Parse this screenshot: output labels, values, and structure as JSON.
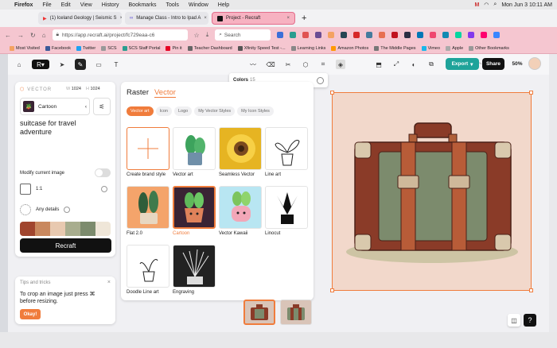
{
  "menubar": {
    "app": "Firefox",
    "items": [
      "File",
      "Edit",
      "View",
      "History",
      "Bookmarks",
      "Tools",
      "Window",
      "Help"
    ],
    "clock": "Mon Jun 3  10:11 AM"
  },
  "tabs": [
    {
      "title": "(1) Iceland Geology | Seismic S"
    },
    {
      "title": "Manage Class - Intro to Ipad A"
    },
    {
      "title": "Project - Recraft"
    }
  ],
  "nav": {
    "url": "https://app.recraft.ai/project/fc729eaa-c6",
    "search_placeholder": "Search"
  },
  "bookmarks": [
    "Most Visited",
    "Facebook",
    "Twitter",
    "SCS",
    "SCS Staff Portal",
    "Pin it",
    "Teacher Dashboard",
    "Xfinity Speed Test -...",
    "Learning Links",
    "Amazon Photos",
    "The Middle Pages",
    "Vimeo",
    "Apple",
    "Other Bookmarks"
  ],
  "toolbar": {
    "export_label": "Export",
    "share_label": "Share",
    "zoom": "50%"
  },
  "colors_popup": {
    "label": "Colors",
    "count": "15"
  },
  "left_panel": {
    "section": "VECTOR",
    "width_label": "W",
    "width": "1024",
    "height_label": "H",
    "height": "1024",
    "style_name": "Cartoon",
    "prompt": "suitcase for travel adventure",
    "modify_label": "Modify current image",
    "ratio_label": "1:1",
    "details_label": "Any details",
    "palette": [
      "#a0452e",
      "#c9885e",
      "#e8c9b0",
      "#a8ad8e",
      "#7c8b6d",
      "#efe6d8"
    ],
    "generate_label": "Recraft"
  },
  "tips": {
    "title": "Tips and tricks",
    "body": "To crop an image just press ⌘ before resizing.",
    "ok_label": "Okay!"
  },
  "style_panel": {
    "tabs": [
      "Raster",
      "Vector"
    ],
    "chips": [
      "Vector art",
      "Icon",
      "Logo",
      "My Vector Styles",
      "My Icon Styles"
    ],
    "cards": [
      {
        "label": "Create brand style"
      },
      {
        "label": "Vector art"
      },
      {
        "label": "Seamless Vector"
      },
      {
        "label": "Line art"
      },
      {
        "label": "Flat 2.0"
      },
      {
        "label": "Cartoon"
      },
      {
        "label": "Vector Kawaii"
      },
      {
        "label": "Linocut"
      },
      {
        "label": "Doodle Line art"
      },
      {
        "label": "Engraving"
      }
    ]
  },
  "accent": "#f07c3c"
}
